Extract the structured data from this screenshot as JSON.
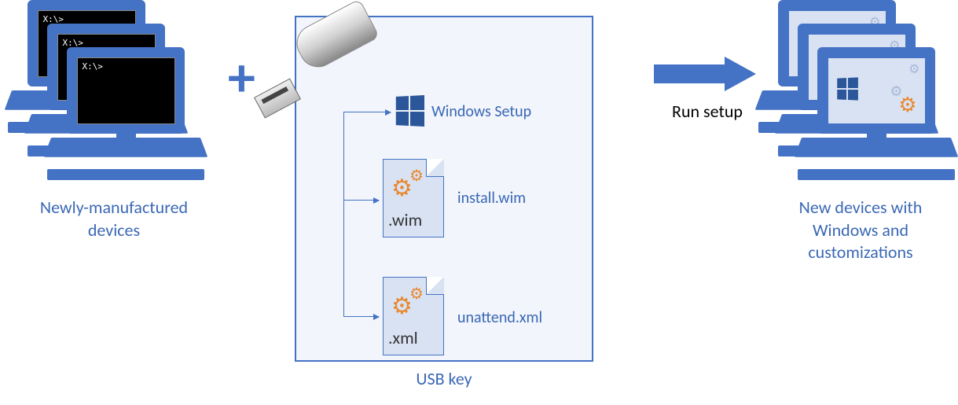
{
  "left": {
    "prompt": "X:\\>",
    "caption": "Newly-manufactured devices"
  },
  "plus": "+",
  "usb": {
    "caption": "USB key",
    "items": {
      "windows_setup": "Windows Setup",
      "install_wim": {
        "label": "install.wim",
        "ext": ".wim"
      },
      "unattend_xml": {
        "label": "unattend.xml",
        "ext": ".xml"
      }
    }
  },
  "arrow": {
    "label": "Run setup"
  },
  "right": {
    "caption": "New devices with Windows and customizations"
  }
}
